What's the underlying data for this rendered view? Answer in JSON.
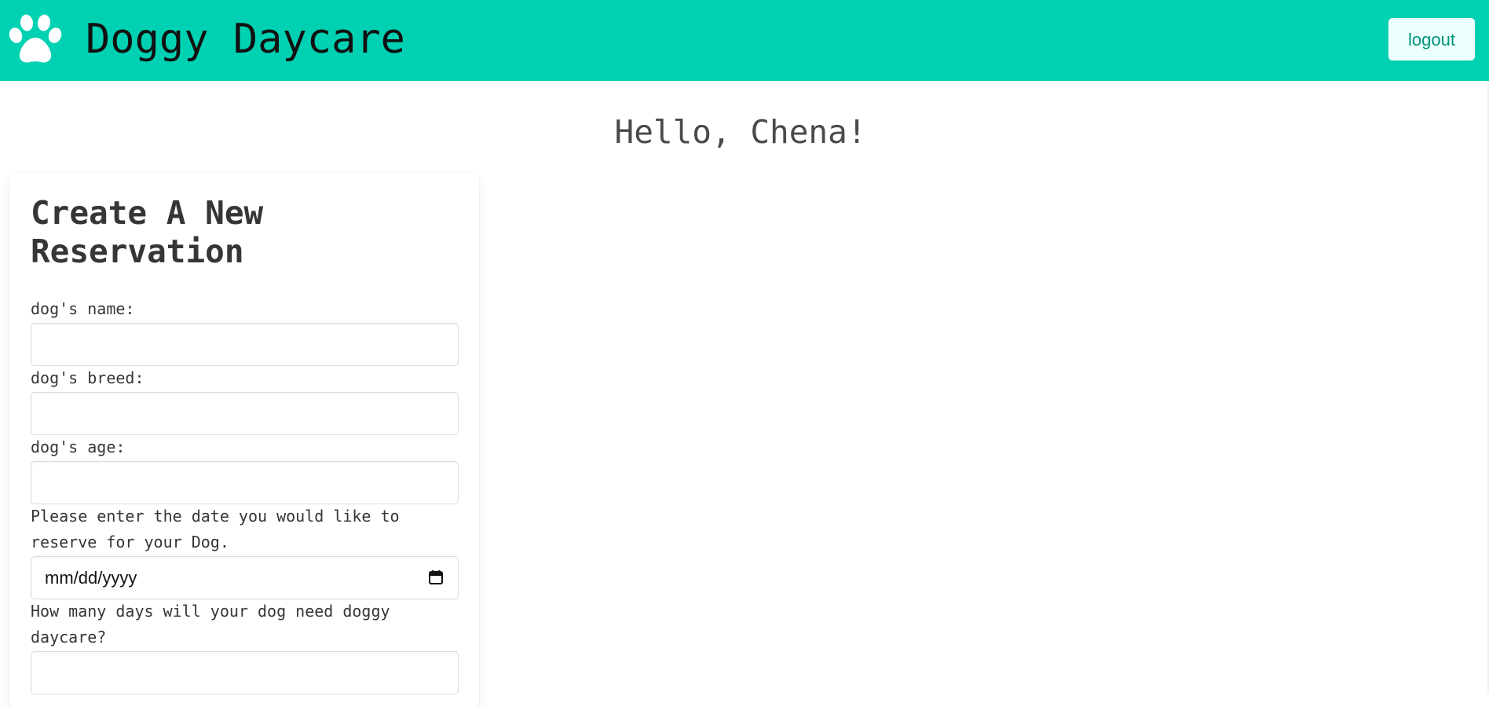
{
  "app": {
    "brand_title": "Doggy Daycare",
    "brand_icon": "paw-icon",
    "logout_label": "logout"
  },
  "colors": {
    "navbar": "#00d1b2",
    "logout_bg": "#ebfffc",
    "logout_text": "#00947e"
  },
  "greeting": "Hello, Chena!",
  "form": {
    "title": "Create A New Reservation",
    "fields": [
      {
        "label": "dog's name:",
        "value": ""
      },
      {
        "label": "dog's breed:",
        "value": ""
      },
      {
        "label": "dog's age:",
        "value": ""
      },
      {
        "label": "Please enter the date you would like to reserve for your Dog.",
        "placeholder": "mm/dd/yyyy",
        "icon": "calendar-icon"
      },
      {
        "label": "How many days will your dog need doggy daycare?",
        "value": ""
      }
    ]
  }
}
